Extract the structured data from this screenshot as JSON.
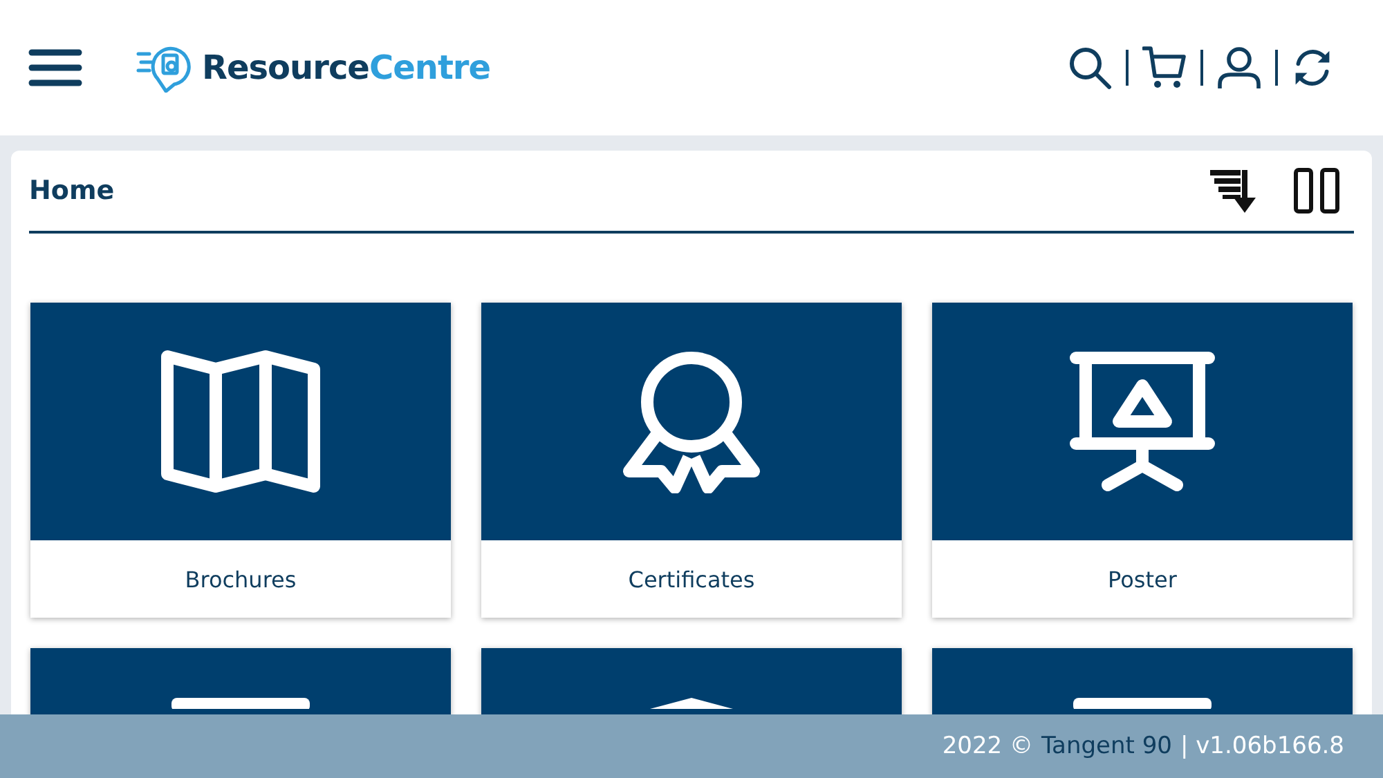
{
  "header": {
    "logo": {
      "dark": "Resource",
      "light": "Centre"
    }
  },
  "page": {
    "title": "Home"
  },
  "tiles": [
    {
      "kind": "map",
      "label": "Brochures"
    },
    {
      "kind": "award",
      "label": "Certificates"
    },
    {
      "kind": "presentation",
      "label": "Poster"
    },
    {
      "kind": "bar"
    },
    {
      "kind": "peak"
    },
    {
      "kind": "bar"
    }
  ],
  "footer": {
    "year": "2022 ©",
    "link": "Tangent 90",
    "version": "| v1.06b166.8"
  }
}
